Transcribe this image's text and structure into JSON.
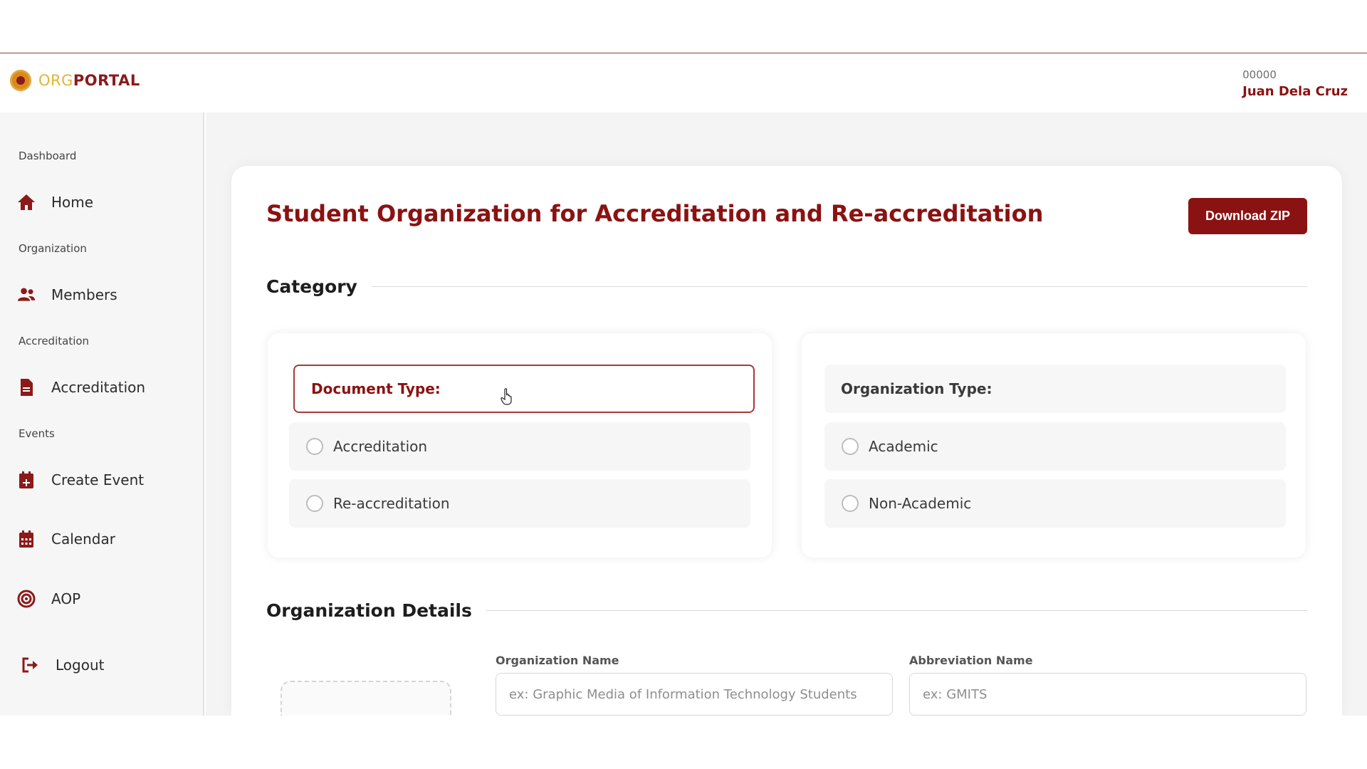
{
  "app": {
    "logo_text_a": "ORG",
    "logo_text_b": "PORTAL",
    "user_id": "00000",
    "user_name": "Juan Dela Cruz"
  },
  "sidebar": {
    "sections": [
      {
        "label": "Dashboard"
      },
      {
        "label": "Organization"
      },
      {
        "label": "Accreditation"
      },
      {
        "label": "Events"
      }
    ],
    "items": [
      {
        "label": "Home",
        "icon": "home-icon"
      },
      {
        "label": "Members",
        "icon": "members-icon"
      },
      {
        "label": "Accreditation",
        "icon": "document-icon"
      },
      {
        "label": "Create Event",
        "icon": "calendar-plus-icon"
      },
      {
        "label": "Calendar",
        "icon": "calendar-icon"
      },
      {
        "label": "AOP",
        "icon": "target-icon"
      },
      {
        "label": "Logout",
        "icon": "logout-icon"
      }
    ]
  },
  "main": {
    "title": "Student Organization for Accreditation and Re-accreditation",
    "download_label": "Download ZIP",
    "category_heading": "Category",
    "document_type": {
      "label": "Document Type:",
      "options": [
        "Accreditation",
        "Re-accreditation"
      ]
    },
    "organization_type": {
      "label": "Organization Type:",
      "options": [
        "Academic",
        "Non-Academic"
      ]
    },
    "details_heading": "Organization Details",
    "org_name": {
      "label": "Organization Name",
      "placeholder": "ex: Graphic Media of Information Technology Students",
      "value": ""
    },
    "abbreviation": {
      "label": "Abbreviation Name",
      "placeholder": "ex: GMITS",
      "value": ""
    }
  },
  "colors": {
    "brand_primary": "#8b1212",
    "brand_gold": "#e2b43a",
    "sidebar_bg": "#f6f6f6"
  }
}
